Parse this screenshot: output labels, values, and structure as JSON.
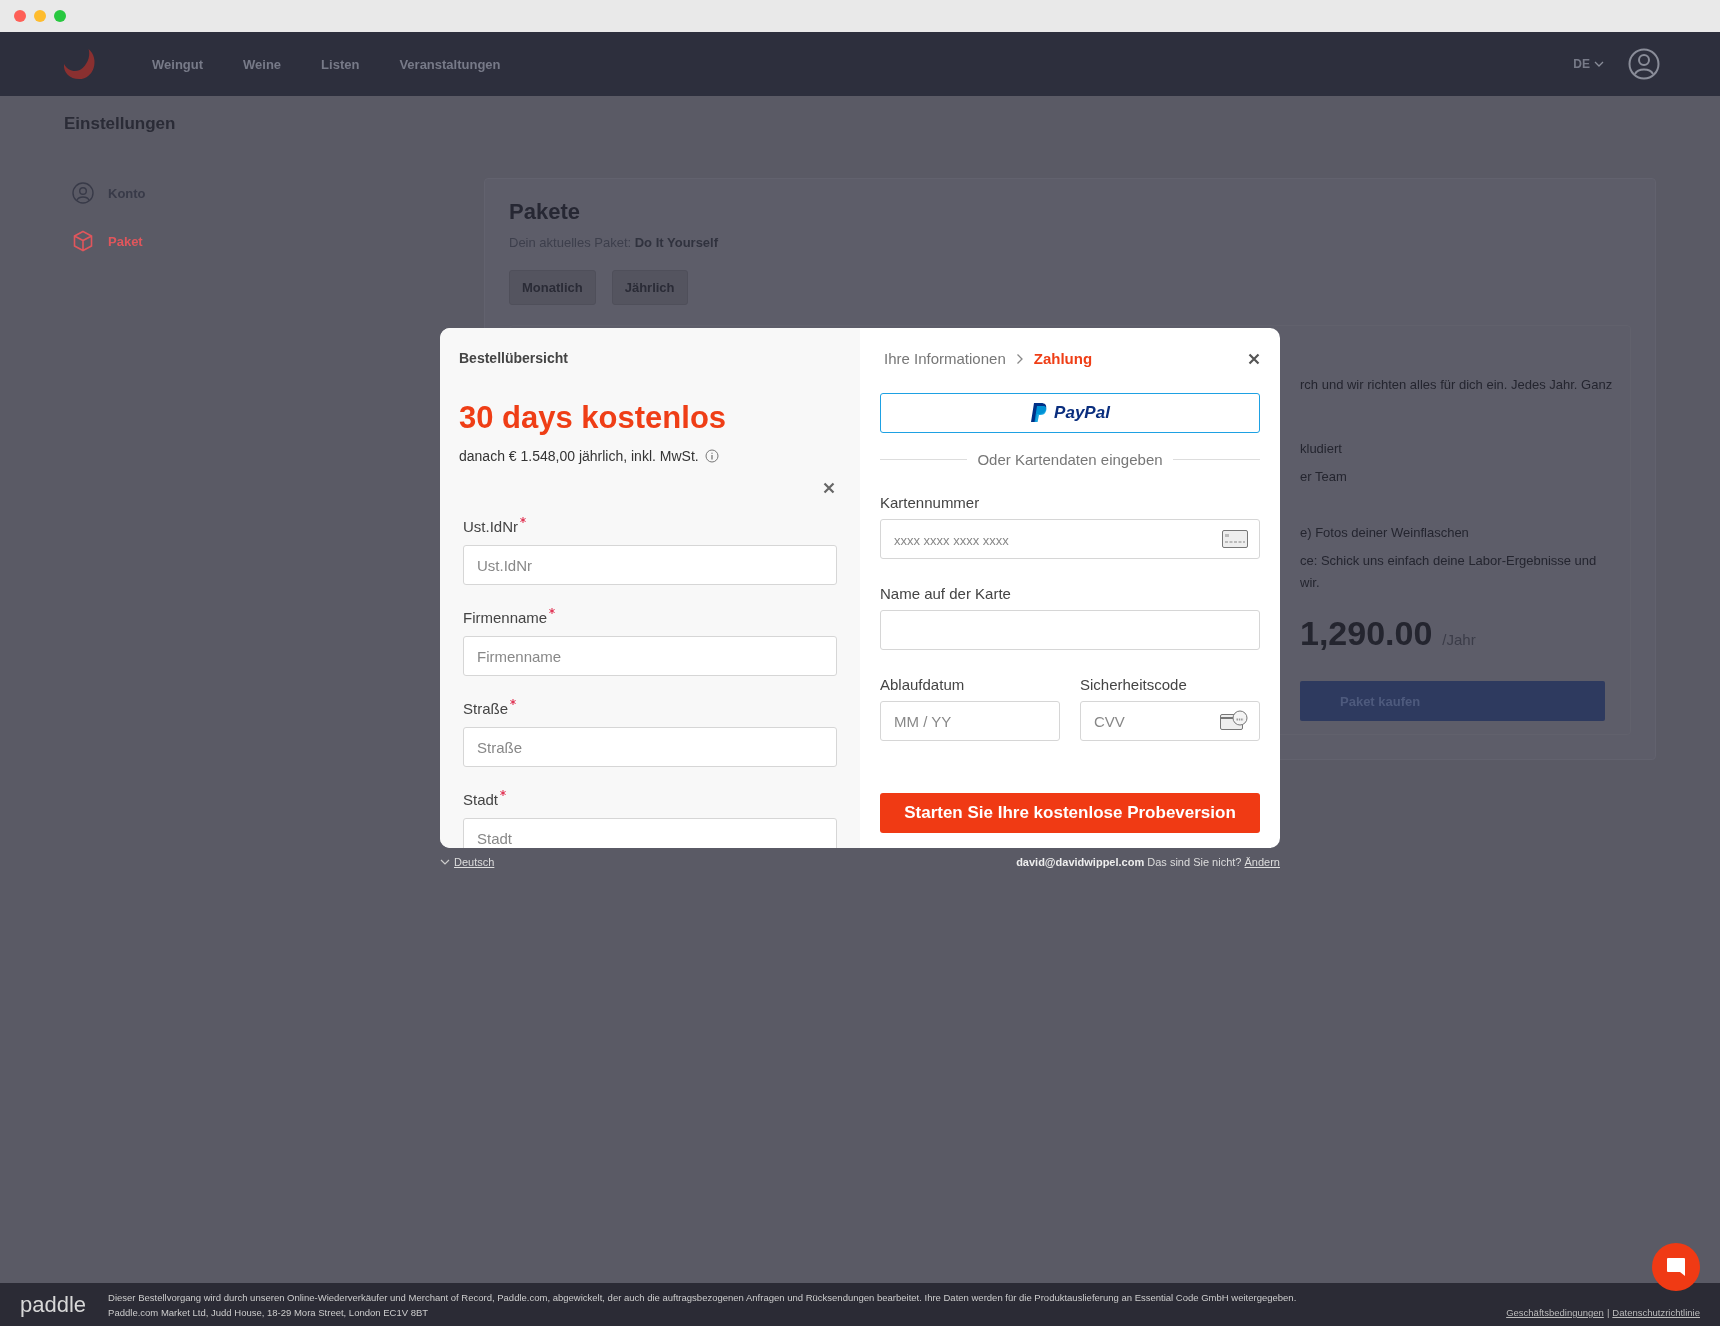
{
  "nav": {
    "links": [
      {
        "label": "Weingut"
      },
      {
        "label": "Weine"
      },
      {
        "label": "Listen"
      },
      {
        "label": "Veranstaltungen"
      }
    ],
    "language": "DE"
  },
  "page_title": "Einstellungen",
  "sidebar": {
    "items": [
      {
        "label": "Konto",
        "selected": false
      },
      {
        "label": "Paket",
        "selected": true
      }
    ]
  },
  "packages": {
    "title": "Pakete",
    "current_label": "Dein aktuelles Paket:",
    "current_value": "Do It Yourself",
    "periods": [
      {
        "label": "Monatlich"
      },
      {
        "label": "Jährlich"
      }
    ],
    "plan_lines": [
      "rch und wir richten alles für dich ein. Jedes Jahr. Ganz",
      "kludiert",
      "er Team",
      "e) Fotos deiner Weinflaschen",
      "ce: Schick uns einfach deine Labor-Ergebnisse und",
      "wir."
    ],
    "price": "1,290.00",
    "price_unit": "/Jahr",
    "buy_button": "Paket kaufen"
  },
  "checkout": {
    "summary_title": "Bestellübersicht",
    "headline": "30 days kostenlos",
    "price_note": "danach € 1.548,00 jährlich, inkl. MwSt.",
    "fields": [
      {
        "label": "Ust.IdNr",
        "placeholder": "Ust.IdNr",
        "required": true
      },
      {
        "label": "Firmenname",
        "placeholder": "Firmenname",
        "required": true
      },
      {
        "label": "Straße",
        "placeholder": "Straße",
        "required": true
      },
      {
        "label": "Stadt",
        "placeholder": "Stadt",
        "required": true
      }
    ],
    "steps": [
      {
        "label": "Ihre Informationen",
        "selected": false
      },
      {
        "label": "Zahlung",
        "selected": true
      }
    ],
    "paypal": {
      "label": "PayPal"
    },
    "divider": "Oder Kartendaten eingeben",
    "card_number": {
      "label": "Kartennummer",
      "placeholder": "xxxx xxxx xxxx xxxx"
    },
    "card_name": {
      "label": "Name auf der Karte"
    },
    "expiry": {
      "label": "Ablaufdatum",
      "placeholder": "MM / YY"
    },
    "cvv": {
      "label": "Sicherheitscode",
      "placeholder": "CVV"
    },
    "submit": "Starten Sie Ihre kostenlose Probeversion",
    "language": "Deutsch",
    "email": "david@davidwippel.com",
    "not_you": "Das sind Sie nicht?",
    "change": "Ändern"
  },
  "footer": {
    "logo": "paddle",
    "line_1": "Dieser Bestellvorgang wird durch unseren Online-Wiederverkäufer und Merchant of Record, Paddle.com, abgewickelt, der auch die auftragsbezogenen Anfragen und Rücksendungen bearbeitet.  Ihre Daten werden für die Produktauslieferung an Essential Code GmbH weitergegeben.",
    "line_2": "Paddle.com Market Ltd, Judd House, 18-29 Mora Street, London EC1V 8BT",
    "links": [
      {
        "label": "Geschäftsbedingungen"
      },
      {
        "label": "Datenschutzrichtlinie"
      }
    ],
    "separator": "|"
  }
}
